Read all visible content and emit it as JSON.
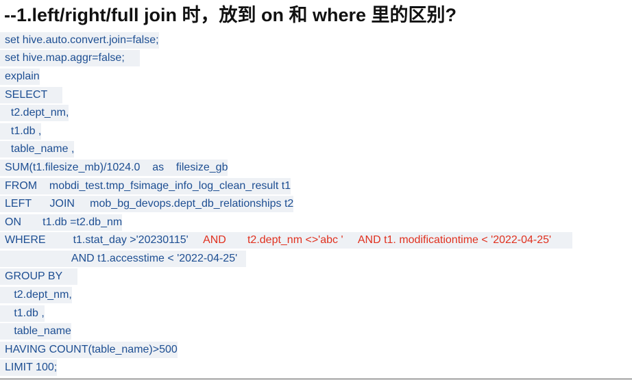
{
  "title": "--1.left/right/full join  时，放到 on 和 where 里的区别?",
  "code_lines": [
    [
      {
        "text": "set hive.auto.convert.join=false;",
        "color": "#1d4e92"
      }
    ],
    [
      {
        "text": "set hive.map.aggr=false;     ",
        "color": "#1d4e92"
      }
    ],
    [
      {
        "text": "explain",
        "color": "#1d4e92"
      }
    ],
    [
      {
        "text": "SELECT     ",
        "color": "#1d4e92"
      }
    ],
    [
      {
        "text": "  t2.dept_nm,",
        "color": "#1d4e92"
      }
    ],
    [
      {
        "text": "  t1.db ,",
        "color": "#1d4e92"
      }
    ],
    [
      {
        "text": "  table_name ,",
        "color": "#1d4e92"
      }
    ],
    [
      {
        "text": "SUM(t1.filesize_mb)/1024.0    as    filesize_gb",
        "color": "#1d4e92"
      }
    ],
    [
      {
        "text": "FROM    mobdi_test.tmp_fsimage_info_log_clean_result t1",
        "color": "#1d4e92"
      }
    ],
    [
      {
        "text": "LEFT      JOIN     mob_bg_devops.dept_db_relationships t2",
        "color": "#1d4e92"
      }
    ],
    [
      {
        "text": "ON       t1.db =t2.db_nm",
        "color": "#1d4e92"
      }
    ],
    [
      {
        "text": "WHERE         t1.stat_day >'20230115'     ",
        "color": "#1d4e92"
      },
      {
        "text": "AND       t2.dept_nm <>'abc '     AND t1. modificationtime < '2022-04-25'       ",
        "color": "#e0301e"
      }
    ],
    [
      {
        "text": "                      AND t1.accesstime < '2022-04-25'   ",
        "color": "#1d4e92"
      }
    ],
    [
      {
        "text": "GROUP BY     ",
        "color": "#1d4e92"
      }
    ],
    [
      {
        "text": "   t2.dept_nm,",
        "color": "#1d4e92"
      }
    ],
    [
      {
        "text": "   t1.db ,",
        "color": "#1d4e92"
      }
    ],
    [
      {
        "text": "   table_name",
        "color": "#1d4e92"
      }
    ],
    [
      {
        "text": "HAVING COUNT(table_name)>500",
        "color": "#1d4e92"
      }
    ],
    [
      {
        "text": "LIMIT 100;",
        "color": "#1d4e92"
      }
    ]
  ]
}
